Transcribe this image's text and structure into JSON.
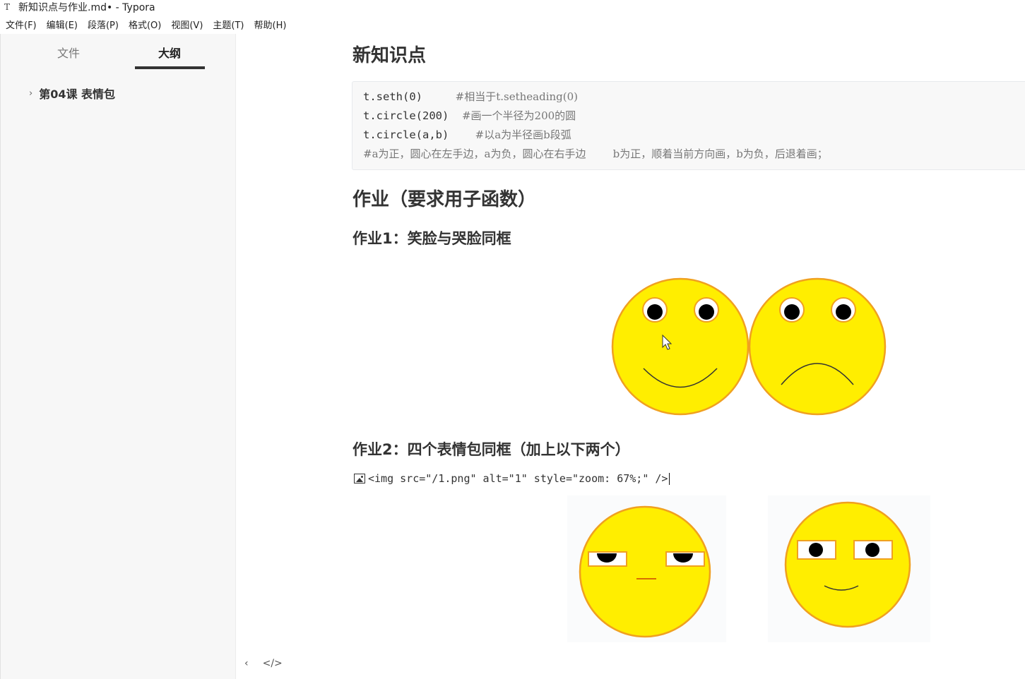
{
  "window": {
    "app_icon": "T",
    "title": "新知识点与作业.md• - Typora"
  },
  "menubar": {
    "items": [
      "文件(F)",
      "编辑(E)",
      "段落(P)",
      "格式(O)",
      "视图(V)",
      "主题(T)",
      "帮助(H)"
    ]
  },
  "sidebar": {
    "tabs": [
      {
        "label": "文件",
        "active": false
      },
      {
        "label": "大纲",
        "active": true
      }
    ],
    "outline": [
      {
        "label": "第04课 表情包",
        "expanded": false
      }
    ]
  },
  "document": {
    "heading1": "新知识点",
    "code_lines": [
      {
        "code": "t.seth(0)     ",
        "comment": "#相当于t.setheading(0)"
      },
      {
        "code": "t.circle(200)  ",
        "comment": "#画一个半径为200的圆"
      },
      {
        "code": "t.circle(a,b)    ",
        "comment": "#以a为半径画b段弧"
      },
      {
        "code": "",
        "comment": "#a为正，圆心在左手边，a为负，圆心在右手边        b为正，顺着当前方向画，b为负，后退着画；"
      }
    ],
    "heading2": "作业（要求用子函数）",
    "task1_heading": "作业1：笑脸与哭脸同框",
    "task2_heading": "作业2：四个表情包同框（加上以下两个）",
    "img_source": "<img src=\"/1.png\" alt=\"1\" style=\"zoom: 67%;\" />",
    "face_color": "#ffee00",
    "face_outline": "#f0a020"
  },
  "footer": {
    "back_icon": "chevron-left-icon",
    "source_icon": "code-icon",
    "back_glyph": "‹",
    "source_glyph": "</>"
  }
}
